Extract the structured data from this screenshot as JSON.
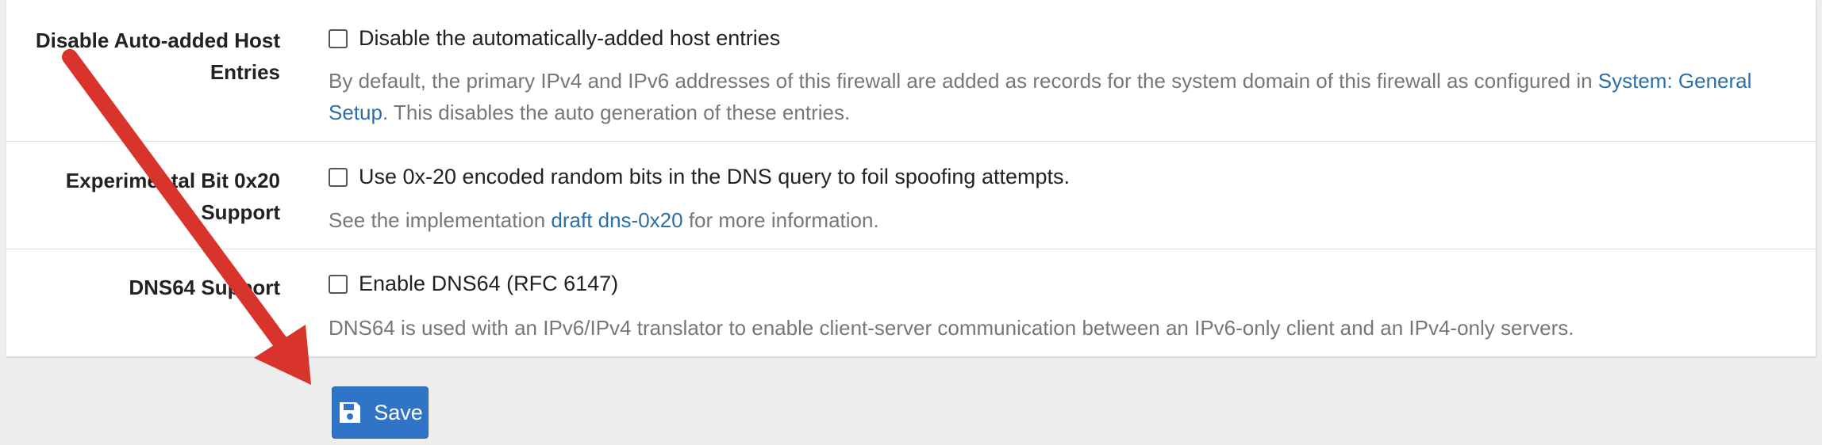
{
  "rows": [
    {
      "label_line1": "Disable Auto-added Host",
      "label_line2": "Entries",
      "checkbox_label": "Disable the automatically-added host entries",
      "help_before": "By default, the primary IPv4 and IPv6 addresses of this firewall are added as records for the system domain of this firewall as configured in ",
      "help_link": "System: General Setup",
      "help_after": ". This disables the auto generation of these entries."
    },
    {
      "label_line1": "Experimental Bit 0x20",
      "label_line2": "Support",
      "checkbox_label": "Use 0x-20 encoded random bits in the DNS query to foil spoofing attempts.",
      "help_before": "See the implementation ",
      "help_link": "draft dns-0x20",
      "help_after": " for more information."
    },
    {
      "label_line1": "DNS64 Support",
      "checkbox_label": "Enable DNS64 (RFC 6147)",
      "help_text": "DNS64 is used with an IPv6/IPv4 translator to enable client-server communication between an IPv6-only client and an IPv4-only servers."
    }
  ],
  "save_button": {
    "label": "Save",
    "icon": "floppy-disk-icon"
  },
  "colors": {
    "accent": "#2f74c7",
    "link": "#2c6fa8",
    "annotation_arrow": "#d9342b"
  }
}
